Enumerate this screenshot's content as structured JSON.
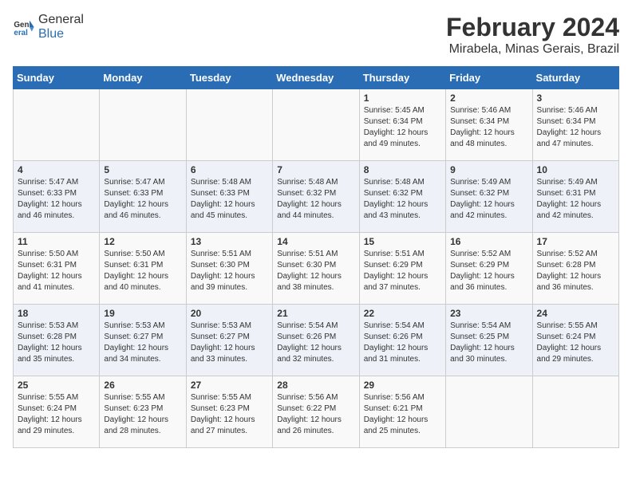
{
  "logo": {
    "general": "General",
    "blue": "Blue"
  },
  "title": "February 2024",
  "subtitle": "Mirabela, Minas Gerais, Brazil",
  "days_of_week": [
    "Sunday",
    "Monday",
    "Tuesday",
    "Wednesday",
    "Thursday",
    "Friday",
    "Saturday"
  ],
  "weeks": [
    [
      {
        "day": "",
        "info": ""
      },
      {
        "day": "",
        "info": ""
      },
      {
        "day": "",
        "info": ""
      },
      {
        "day": "",
        "info": ""
      },
      {
        "day": "1",
        "info": "Sunrise: 5:45 AM\nSunset: 6:34 PM\nDaylight: 12 hours\nand 49 minutes."
      },
      {
        "day": "2",
        "info": "Sunrise: 5:46 AM\nSunset: 6:34 PM\nDaylight: 12 hours\nand 48 minutes."
      },
      {
        "day": "3",
        "info": "Sunrise: 5:46 AM\nSunset: 6:34 PM\nDaylight: 12 hours\nand 47 minutes."
      }
    ],
    [
      {
        "day": "4",
        "info": "Sunrise: 5:47 AM\nSunset: 6:33 PM\nDaylight: 12 hours\nand 46 minutes."
      },
      {
        "day": "5",
        "info": "Sunrise: 5:47 AM\nSunset: 6:33 PM\nDaylight: 12 hours\nand 46 minutes."
      },
      {
        "day": "6",
        "info": "Sunrise: 5:48 AM\nSunset: 6:33 PM\nDaylight: 12 hours\nand 45 minutes."
      },
      {
        "day": "7",
        "info": "Sunrise: 5:48 AM\nSunset: 6:32 PM\nDaylight: 12 hours\nand 44 minutes."
      },
      {
        "day": "8",
        "info": "Sunrise: 5:48 AM\nSunset: 6:32 PM\nDaylight: 12 hours\nand 43 minutes."
      },
      {
        "day": "9",
        "info": "Sunrise: 5:49 AM\nSunset: 6:32 PM\nDaylight: 12 hours\nand 42 minutes."
      },
      {
        "day": "10",
        "info": "Sunrise: 5:49 AM\nSunset: 6:31 PM\nDaylight: 12 hours\nand 42 minutes."
      }
    ],
    [
      {
        "day": "11",
        "info": "Sunrise: 5:50 AM\nSunset: 6:31 PM\nDaylight: 12 hours\nand 41 minutes."
      },
      {
        "day": "12",
        "info": "Sunrise: 5:50 AM\nSunset: 6:31 PM\nDaylight: 12 hours\nand 40 minutes."
      },
      {
        "day": "13",
        "info": "Sunrise: 5:51 AM\nSunset: 6:30 PM\nDaylight: 12 hours\nand 39 minutes."
      },
      {
        "day": "14",
        "info": "Sunrise: 5:51 AM\nSunset: 6:30 PM\nDaylight: 12 hours\nand 38 minutes."
      },
      {
        "day": "15",
        "info": "Sunrise: 5:51 AM\nSunset: 6:29 PM\nDaylight: 12 hours\nand 37 minutes."
      },
      {
        "day": "16",
        "info": "Sunrise: 5:52 AM\nSunset: 6:29 PM\nDaylight: 12 hours\nand 36 minutes."
      },
      {
        "day": "17",
        "info": "Sunrise: 5:52 AM\nSunset: 6:28 PM\nDaylight: 12 hours\nand 36 minutes."
      }
    ],
    [
      {
        "day": "18",
        "info": "Sunrise: 5:53 AM\nSunset: 6:28 PM\nDaylight: 12 hours\nand 35 minutes."
      },
      {
        "day": "19",
        "info": "Sunrise: 5:53 AM\nSunset: 6:27 PM\nDaylight: 12 hours\nand 34 minutes."
      },
      {
        "day": "20",
        "info": "Sunrise: 5:53 AM\nSunset: 6:27 PM\nDaylight: 12 hours\nand 33 minutes."
      },
      {
        "day": "21",
        "info": "Sunrise: 5:54 AM\nSunset: 6:26 PM\nDaylight: 12 hours\nand 32 minutes."
      },
      {
        "day": "22",
        "info": "Sunrise: 5:54 AM\nSunset: 6:26 PM\nDaylight: 12 hours\nand 31 minutes."
      },
      {
        "day": "23",
        "info": "Sunrise: 5:54 AM\nSunset: 6:25 PM\nDaylight: 12 hours\nand 30 minutes."
      },
      {
        "day": "24",
        "info": "Sunrise: 5:55 AM\nSunset: 6:24 PM\nDaylight: 12 hours\nand 29 minutes."
      }
    ],
    [
      {
        "day": "25",
        "info": "Sunrise: 5:55 AM\nSunset: 6:24 PM\nDaylight: 12 hours\nand 29 minutes."
      },
      {
        "day": "26",
        "info": "Sunrise: 5:55 AM\nSunset: 6:23 PM\nDaylight: 12 hours\nand 28 minutes."
      },
      {
        "day": "27",
        "info": "Sunrise: 5:55 AM\nSunset: 6:23 PM\nDaylight: 12 hours\nand 27 minutes."
      },
      {
        "day": "28",
        "info": "Sunrise: 5:56 AM\nSunset: 6:22 PM\nDaylight: 12 hours\nand 26 minutes."
      },
      {
        "day": "29",
        "info": "Sunrise: 5:56 AM\nSunset: 6:21 PM\nDaylight: 12 hours\nand 25 minutes."
      },
      {
        "day": "",
        "info": ""
      },
      {
        "day": "",
        "info": ""
      }
    ]
  ]
}
